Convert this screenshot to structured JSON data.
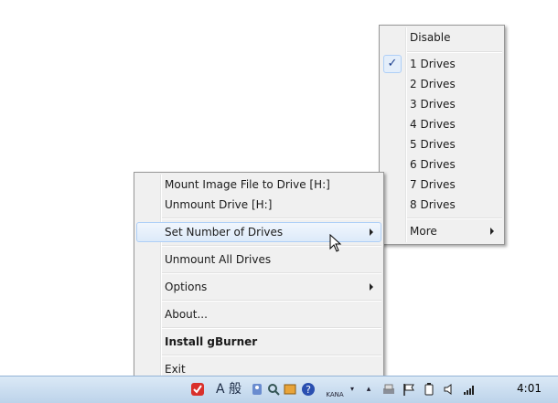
{
  "main_menu": {
    "items": [
      {
        "label": "Mount Image File to Drive [H:]"
      },
      {
        "label": "Unmount Drive [H:]"
      },
      {
        "label": "Set Number of Drives"
      },
      {
        "label": "Unmount All Drives"
      },
      {
        "label": "Options"
      },
      {
        "label": "About..."
      },
      {
        "label": "Install gBurner"
      },
      {
        "label": "Exit"
      }
    ]
  },
  "sub_menu": {
    "disable_label": "Disable",
    "drive_counts": [
      "1 Drives",
      "2 Drives",
      "3 Drives",
      "4 Drives",
      "5 Drives",
      "6 Drives",
      "7 Drives",
      "8 Drives"
    ],
    "selected": "1 Drives",
    "more_label": "More",
    "check_glyph": "✓"
  },
  "taskbar": {
    "ime_label": "A 般",
    "kana_label": "KANA",
    "clock": "4:01"
  },
  "colors": {
    "menu_bg": "#f0f0f0",
    "highlight_border": "#aecff7",
    "taskbar": "#bcd3ea"
  }
}
